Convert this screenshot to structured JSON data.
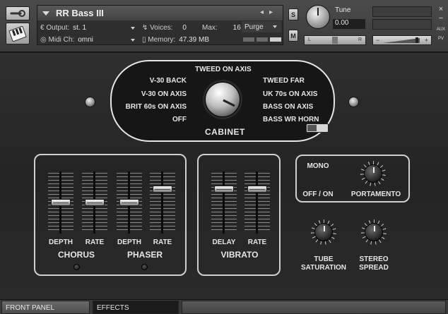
{
  "header": {
    "instrument_name": "RR Bass III",
    "output_label": "Output:",
    "output_value": "st. 1",
    "voices_label": "Voices:",
    "voices_value": "0",
    "max_label": "Max:",
    "max_value": "16",
    "purge_label": "Purge",
    "midi_label": "Midi Ch:",
    "midi_value": "omni",
    "memory_label": "Memory:",
    "memory_value": "47.39 MB",
    "solo_label": "S",
    "mute_label": "M",
    "tune_label": "Tune",
    "tune_value": "0.00",
    "pan_left": "L",
    "pan_right": "R",
    "vol_minus": "−",
    "vol_plus": "+",
    "aux_label": "AUX",
    "pv_label": "PV",
    "close_glyph": "×",
    "minimize_glyph": "−"
  },
  "cabinet": {
    "title": "CABINET",
    "options": {
      "top": "TWEED ON AXIS",
      "left": [
        "V-30 BACK",
        "V-30 ON AXIS",
        "BRIT 60s ON AXIS",
        "OFF"
      ],
      "right": [
        "TWEED FAR",
        "UK 70s ON AXIS",
        "BASS ON AXIS",
        "BASS WR HORN"
      ]
    }
  },
  "chorus": {
    "title": "CHORUS",
    "depth": "DEPTH",
    "rate": "RATE",
    "depth_value": 0.5,
    "rate_value": 0.5
  },
  "phaser": {
    "title": "PHASER",
    "depth": "DEPTH",
    "rate": "RATE",
    "depth_value": 0.5,
    "rate_value": 0.75
  },
  "vibrato": {
    "title": "VIBRATO",
    "delay": "DELAY",
    "rate": "RATE",
    "delay_value": 0.75,
    "rate_value": 0.75
  },
  "mono": {
    "label": "MONO",
    "switch_label": "OFF / ON"
  },
  "portamento": {
    "label": "PORTAMENTO"
  },
  "tube": {
    "label_line1": "TUBE",
    "label_line2": "SATURATION"
  },
  "stereo": {
    "label_line1": "STEREO",
    "label_line2": "SPREAD"
  },
  "tabs": {
    "front_panel": "FRONT PANEL",
    "effects": "EFFECTS"
  },
  "colors": {
    "panel": "#2a2a2a",
    "frame": "#e6e6e6",
    "text": "#e6e6e6"
  }
}
